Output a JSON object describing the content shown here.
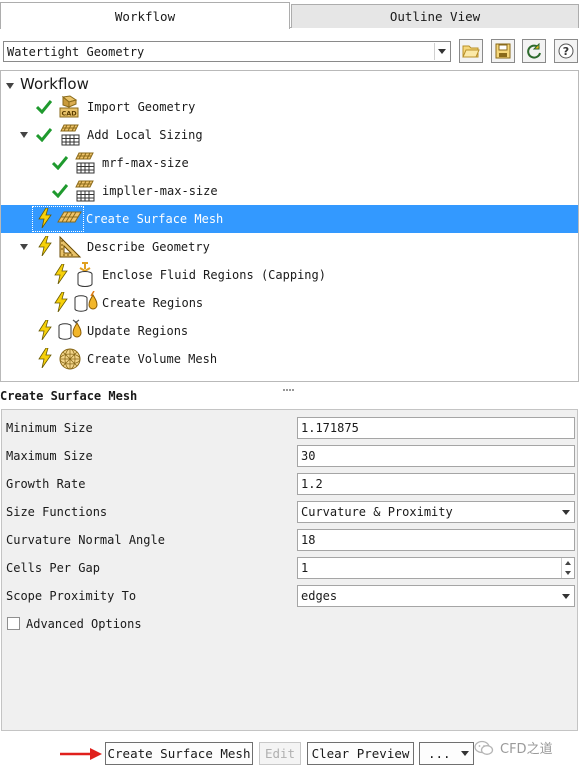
{
  "tabs": [
    {
      "label": "Workflow",
      "active": true
    },
    {
      "label": "Outline View",
      "active": false
    }
  ],
  "toolbar": {
    "workflow_type": "Watertight Geometry",
    "buttons": [
      "folder-open-icon",
      "save-icon",
      "refresh-icon",
      "help-icon"
    ],
    "help_glyph": "?"
  },
  "tree": {
    "root_label": "Workflow",
    "items": [
      {
        "label": "Import Geometry",
        "status": "done",
        "icon": "cad-import-icon",
        "depth": 1
      },
      {
        "label": "Add Local Sizing",
        "status": "done",
        "icon": "mesh-grid-icon",
        "depth": 1,
        "expanded": true
      },
      {
        "label": "mrf-max-size",
        "status": "done",
        "icon": "mesh-grid-icon",
        "depth": 2
      },
      {
        "label": "impller-max-size",
        "status": "done",
        "icon": "mesh-grid-icon",
        "depth": 2
      },
      {
        "label": "Create Surface Mesh",
        "status": "pending",
        "icon": "surface-mesh-icon",
        "depth": 1,
        "selected": true
      },
      {
        "label": "Describe Geometry",
        "status": "pending",
        "icon": "set-square-icon",
        "depth": 1,
        "expanded": true
      },
      {
        "label": "Enclose Fluid Regions (Capping)",
        "status": "pending",
        "icon": "cylinder-cap-icon",
        "depth": 2
      },
      {
        "label": "Create Regions",
        "status": "pending",
        "icon": "cylinder-drop-icon",
        "depth": 2
      },
      {
        "label": "Update Regions",
        "status": "pending",
        "icon": "cylinder-drop-icon",
        "depth": 1
      },
      {
        "label": "Create Volume Mesh",
        "status": "pending",
        "icon": "sphere-mesh-icon",
        "depth": 1
      }
    ]
  },
  "properties": {
    "title": "Create Surface Mesh",
    "rows": [
      {
        "label": "Minimum Size",
        "value": "1.171875",
        "kind": "text"
      },
      {
        "label": "Maximum Size",
        "value": "30",
        "kind": "text"
      },
      {
        "label": "Growth Rate",
        "value": "1.2",
        "kind": "text"
      },
      {
        "label": "Size Functions",
        "value": "Curvature & Proximity",
        "kind": "select"
      },
      {
        "label": "Curvature Normal Angle",
        "value": "18",
        "kind": "text"
      },
      {
        "label": "Cells Per Gap",
        "value": "1",
        "kind": "spin"
      },
      {
        "label": "Scope Proximity To",
        "value": "edges",
        "kind": "select"
      }
    ],
    "advanced_options_label": "Advanced Options",
    "advanced_options_checked": false
  },
  "actions": {
    "primary_label": "Create Surface Mesh",
    "edit_label": "Edit",
    "clear_preview_label": "Clear Preview",
    "more_label": "..."
  },
  "watermark": {
    "text": "CFD之道"
  },
  "colors": {
    "selection": "#3399ff",
    "check": "#1f9a2e",
    "lightning": "#f7d10a",
    "arrow_red": "#e0201c"
  }
}
